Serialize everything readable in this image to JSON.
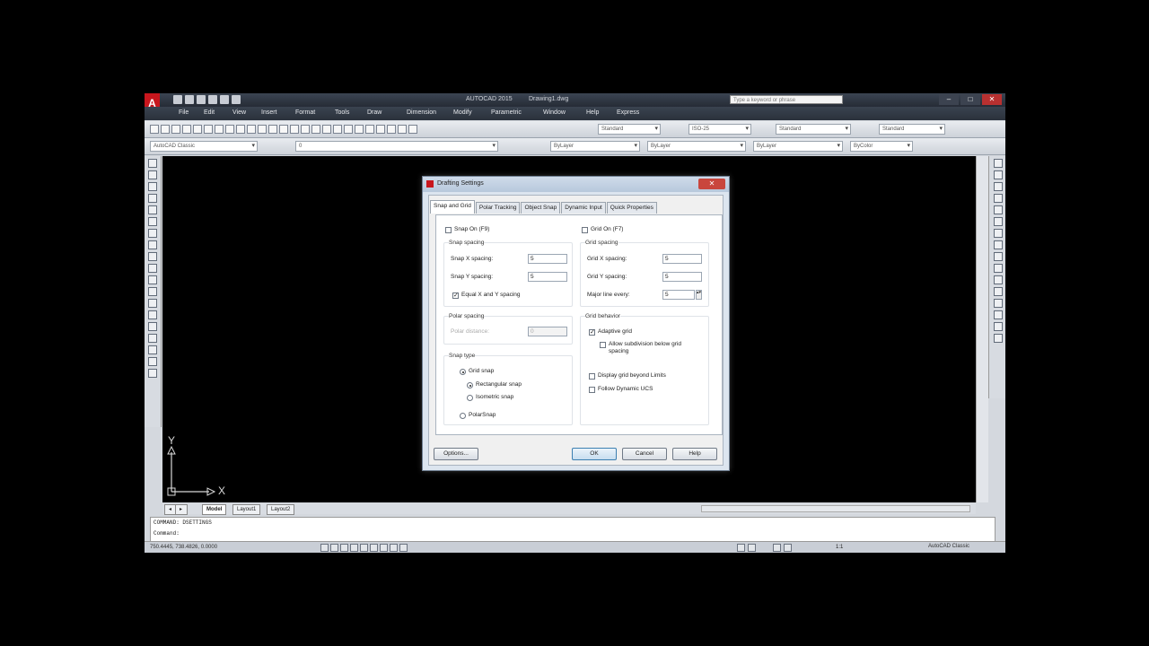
{
  "app": {
    "title": "AUTOCAD 2015",
    "workspace": "Drawing1.dwg",
    "search_placeholder": "Type a keyword or phrase",
    "logo": "A"
  },
  "menubar": [
    "File",
    "Edit",
    "View",
    "Insert",
    "Format",
    "Tools",
    "Draw",
    "Dimension",
    "Modify",
    "Parametric",
    "Window",
    "Help",
    "Express"
  ],
  "toolbar1": {
    "text_style": "Standard",
    "dim_style": "ISO-25",
    "table_style": "Standard",
    "mleader_style": "Standard"
  },
  "toolbar2": {
    "workspace_combo": "AutoCAD Classic",
    "layer": "0",
    "color": "ByLayer",
    "linetype": "ByLayer",
    "lineweight": "ByLayer",
    "plotstyle": "ByColor"
  },
  "ucs": {
    "x_label": "X",
    "y_label": "Y"
  },
  "layout_tabs": [
    "Model",
    "Layout1",
    "Layout2"
  ],
  "command_line": {
    "history": "COMMAND: DSETTINGS",
    "prompt": "Command:"
  },
  "status": {
    "coords": "750.4445, 738.4826, 0.0000",
    "scale": "1:1",
    "workspace": "AutoCAD Classic"
  },
  "dialog": {
    "title": "Drafting Settings",
    "close_label": "✕",
    "tabs": [
      "Snap and Grid",
      "Polar Tracking",
      "Object Snap",
      "Dynamic Input",
      "Quick Properties"
    ],
    "snap_on": "Snap On (F9)",
    "grid_on": "Grid On (F7)",
    "snap_spacing_legend": "Snap spacing",
    "snap_x_label": "Snap X spacing:",
    "snap_x_value": "5",
    "snap_y_label": "Snap Y spacing:",
    "snap_y_value": "5",
    "equal_xy": "Equal X and Y spacing",
    "polar_spacing_legend": "Polar spacing",
    "polar_distance_label": "Polar distance:",
    "polar_distance_value": "0",
    "snap_type_legend": "Snap type",
    "grid_snap": "Grid snap",
    "rect_snap": "Rectangular snap",
    "iso_snap": "Isometric snap",
    "polar_snap": "PolarSnap",
    "grid_spacing_legend": "Grid spacing",
    "grid_x_label": "Grid X spacing:",
    "grid_x_value": "5",
    "grid_y_label": "Grid Y spacing:",
    "grid_y_value": "5",
    "major_line_label": "Major line every:",
    "major_line_value": "5",
    "grid_behavior_legend": "Grid behavior",
    "adaptive_grid": "Adaptive grid",
    "allow_subdivision": "Allow subdivision below grid spacing",
    "display_beyond": "Display grid beyond Limits",
    "follow_ucs": "Follow Dynamic UCS",
    "options_button": "Options...",
    "ok_button": "OK",
    "cancel_button": "Cancel",
    "help_button": "Help"
  }
}
